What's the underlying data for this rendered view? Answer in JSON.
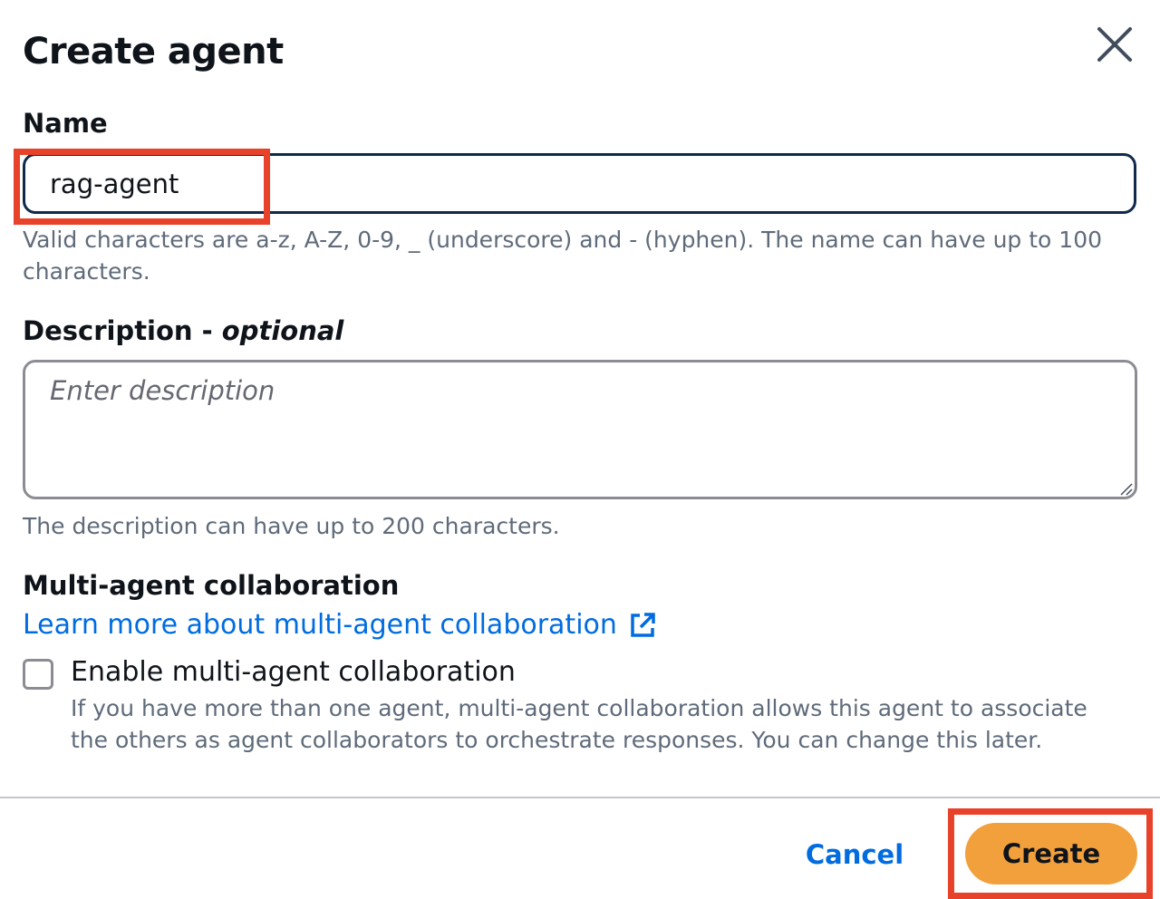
{
  "modal": {
    "title": "Create agent",
    "close_icon": "close-icon"
  },
  "name_field": {
    "label": "Name",
    "value": "rag-agent",
    "hint": "Valid characters are a-z, A-Z, 0-9, _ (underscore) and - (hyphen). The name can have up to 100 characters."
  },
  "description_field": {
    "label": "Description - ",
    "label_optional": "optional",
    "placeholder": "Enter description",
    "hint": "The description can have up to 200 characters."
  },
  "collaboration": {
    "heading": "Multi-agent collaboration",
    "link_text": "Learn more about multi-agent collaboration",
    "link_icon": "external-link-icon",
    "checkbox_label": "Enable multi-agent collaboration",
    "checkbox_checked": false,
    "checkbox_description": "If you have more than one agent, multi-agent collaboration allows this agent to associate the others as agent collaborators to orchestrate responses. You can change this later."
  },
  "footer": {
    "cancel_label": "Cancel",
    "create_label": "Create"
  },
  "colors": {
    "link_blue": "#006ce0",
    "primary_orange": "#f2a03c",
    "highlight_red": "#e8432a",
    "input_border_focus": "#0f2a4a"
  }
}
